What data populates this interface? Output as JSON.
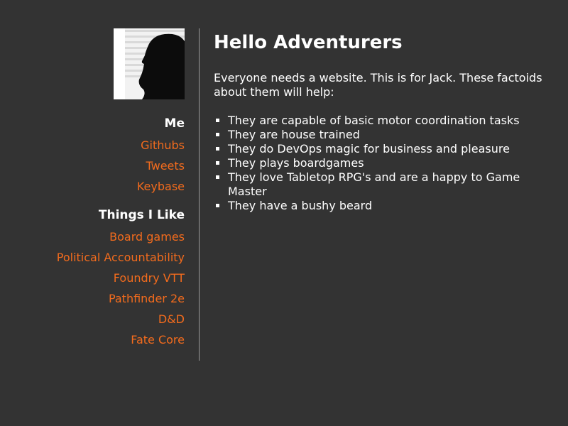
{
  "sidebar": {
    "me_title": "Me",
    "me_links": [
      "Githubs",
      "Tweets",
      "Keybase"
    ],
    "likes_title": "Things I Like",
    "likes_links": [
      "Board games",
      "Political Accountability",
      "Foundry VTT",
      "Pathfinder 2e",
      "D&D",
      "Fate Core"
    ]
  },
  "main": {
    "title": "Hello Adventurers",
    "intro": "Everyone needs a website. This is for Jack. These factoids about them will help:",
    "facts": [
      "They are capable of basic motor coordination tasks",
      "They are house trained",
      "They do DevOps magic for business and pleasure",
      "They plays boardgames",
      "They love Tabletop RPG's and are a happy to Game Master",
      "They have a bushy beard"
    ]
  },
  "colors": {
    "background": "#333333",
    "link": "#f26b1d",
    "text": "#ffffff",
    "divider": "#9a9a9a"
  }
}
